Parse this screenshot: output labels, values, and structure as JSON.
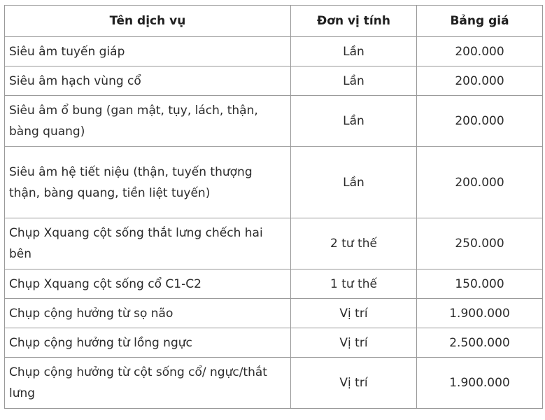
{
  "table": {
    "headers": {
      "service": "Tên dịch vụ",
      "unit": "Đơn vị tính",
      "price": "Bảng giá"
    },
    "rows": [
      {
        "service": "Siêu âm tuyến giáp",
        "unit": "Lần",
        "price": "200.000"
      },
      {
        "service": "Siêu âm hạch vùng cổ",
        "unit": "Lần",
        "price": "200.000"
      },
      {
        "service": "Siêu âm ổ bung (gan mật, tụy, lách, thận, bàng quang)",
        "unit": "Lần",
        "price": "200.000"
      },
      {
        "service": "Siêu âm hệ tiết niệu (thận, tuyến thượng thận, bàng quang, tiền liệt tuyến)",
        "unit": "Lần",
        "price": "200.000"
      },
      {
        "service": "Chụp Xquang cột sống thắt lưng chếch hai bên",
        "unit": "2 tư thế",
        "price": "250.000"
      },
      {
        "service": "Chụp Xquang cột sống cổ C1-C2",
        "unit": "1 tư thế",
        "price": "150.000"
      },
      {
        "service": "Chụp cộng hưởng từ sọ não",
        "unit": "Vị trí",
        "price": "1.900.000"
      },
      {
        "service": "Chụp cộng hưởng từ lồng ngực",
        "unit": "Vị trí",
        "price": "2.500.000"
      },
      {
        "service": "Chụp cộng hưởng từ cột sống cổ/ ngực/thắt lưng",
        "unit": "Vị trí",
        "price": "1.900.000"
      }
    ]
  }
}
